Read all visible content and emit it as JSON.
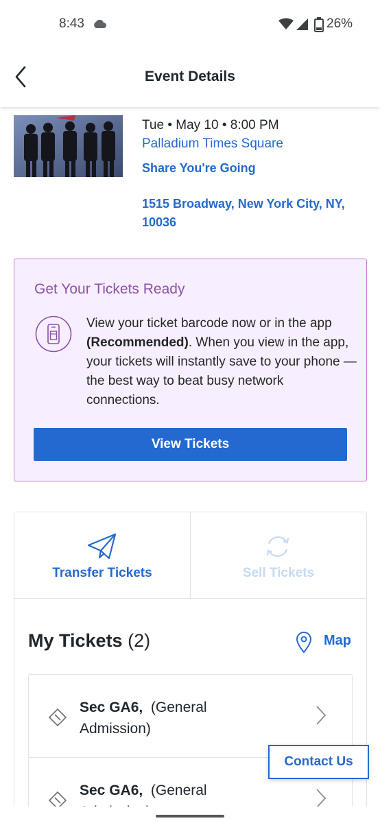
{
  "status_bar": {
    "time": "8:43",
    "battery": "26%"
  },
  "header": {
    "title": "Event Details"
  },
  "event": {
    "date": "Tue • May 10 • 8:00 PM",
    "venue": "Palladium Times Square",
    "share": "Share You're Going",
    "address": "1515 Broadway, New York City, NY, 10036"
  },
  "ready_card": {
    "title": "Get Your Tickets Ready",
    "text_before": "View your ticket barcode now or in the app ",
    "text_bold": "(Recommended)",
    "text_after": ". When you view in the app, your tickets will instantly save to your phone — the best way to beat busy network connections.",
    "button": "View Tickets"
  },
  "actions": {
    "transfer": "Transfer Tickets",
    "sell": "Sell Tickets"
  },
  "my_tickets": {
    "title": "My Tickets",
    "count": "(2)",
    "map_label": "Map",
    "items": [
      {
        "section": "Sec GA6,",
        "type": "(General Admission)"
      },
      {
        "section": "Sec GA6,",
        "type": "(General Admission)"
      }
    ]
  },
  "contact": {
    "label": "Contact Us"
  },
  "colors": {
    "accent": "#2469cf",
    "purple": "#8e4fa9",
    "card_bg": "#f7efff",
    "sell_disabled": "#c7d9f3"
  }
}
